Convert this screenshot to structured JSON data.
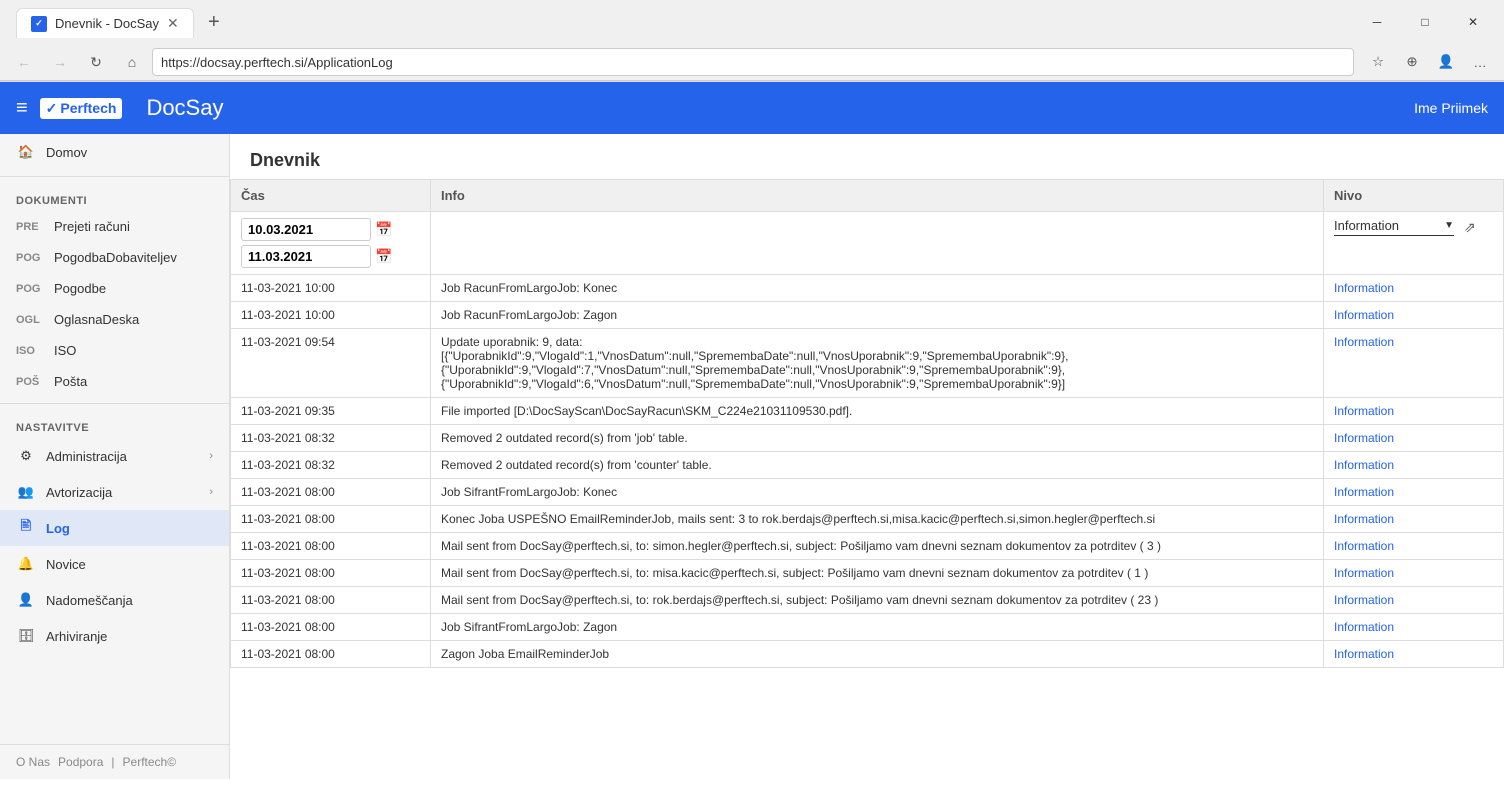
{
  "browser": {
    "tab_title": "Dnevnik - DocSay",
    "tab_favicon": "✓",
    "url": "https://docsay.perftech.si/ApplicationLog",
    "new_tab_btn": "+",
    "controls": {
      "minimize": "─",
      "maximize": "□",
      "close": "✕"
    }
  },
  "nav": {
    "back": "←",
    "forward": "→",
    "refresh": "↻",
    "home": "⌂"
  },
  "header": {
    "menu_icon": "≡",
    "logo_check": "✓",
    "logo_brand": "Perftech",
    "app_name": "DocSay",
    "user_name": "Ime Priimek"
  },
  "sidebar": {
    "domov_label": "Domov",
    "section_dokumenti": "DOKUMENTI",
    "items_dokumenti": [
      {
        "prefix": "PRE",
        "label": "Prejeti računi"
      },
      {
        "prefix": "POG",
        "label": "PogodbaDobaviteljev"
      },
      {
        "prefix": "POG",
        "label": "Pogodbe"
      },
      {
        "prefix": "OGL",
        "label": "OglasnaDeska"
      },
      {
        "prefix": "ISO",
        "label": "ISO"
      },
      {
        "prefix": "POŠ",
        "label": "Pošta"
      }
    ],
    "section_nastavitve": "NASTAVITVE",
    "items_nastavitve": [
      {
        "prefix": "",
        "label": "Administracija",
        "has_arrow": true
      },
      {
        "prefix": "",
        "label": "Avtorizacija",
        "has_arrow": true
      },
      {
        "prefix": "",
        "label": "Log",
        "active": true
      },
      {
        "prefix": "",
        "label": "Novice"
      },
      {
        "prefix": "",
        "label": "Nadomeščanja"
      },
      {
        "prefix": "",
        "label": "Arhiviranje"
      }
    ],
    "footer": {
      "o_nas": "O Nas",
      "podpora": "Podpora",
      "separator": "|",
      "perftech": "Perftech©"
    }
  },
  "page": {
    "title": "Dnevnik"
  },
  "table": {
    "headers": {
      "cas": "Čas",
      "info": "Info",
      "nivo": "Nivo"
    },
    "filter": {
      "date_from": "10.03.2021",
      "date_to": "11.03.2021",
      "level_value": "Information",
      "level_dropdown_arrow": "▼",
      "clear_icon": "⇗"
    },
    "rows": [
      {
        "time": "11-03-2021 10:00",
        "info": "Job RacunFromLargoJob: Konec",
        "level": "Information"
      },
      {
        "time": "11-03-2021 10:00",
        "info": "Job RacunFromLargoJob: Zagon",
        "level": "Information"
      },
      {
        "time": "11-03-2021 09:54",
        "info": "Update uporabnik: 9, data:\n[{\"UporabnikId\":9,\"VlogaId\":1,\"VnosDatum\":null,\"SpremembaDate\":null,\"VnosUporabnik\":9,\"SpremembaUporabnik\":9},\n{\"UporabnikId\":9,\"VlogaId\":7,\"VnosDatum\":null,\"SpremembaDate\":null,\"VnosUporabnik\":9,\"SpremembaUporabnik\":9},\n{\"UporabnikId\":9,\"VlogaId\":6,\"VnosDatum\":null,\"SpremembaDate\":null,\"VnosUporabnik\":9,\"SpremembaUporabnik\":9}]",
        "level": "Information"
      },
      {
        "time": "11-03-2021 09:35",
        "info": "File imported [D:\\DocSayScan\\DocSayRacun\\SKM_C224e21031109530.pdf].",
        "level": "Information"
      },
      {
        "time": "11-03-2021 08:32",
        "info": "Removed 2 outdated record(s) from 'job' table.",
        "level": "Information"
      },
      {
        "time": "11-03-2021 08:32",
        "info": "Removed 2 outdated record(s) from 'counter' table.",
        "level": "Information"
      },
      {
        "time": "11-03-2021 08:00",
        "info": "Job SifrantFromLargoJob: Konec",
        "level": "Information"
      },
      {
        "time": "11-03-2021 08:00",
        "info": "Konec Joba USPEŠNO EmailReminderJob, mails sent: 3 to rok.berdajs@perftech.si,misa.kacic@perftech.si,simon.hegler@perftech.si",
        "level": "Information"
      },
      {
        "time": "11-03-2021 08:00",
        "info": "Mail sent from DocSay@perftech.si, to: simon.hegler@perftech.si, subject: Pošiljamo vam dnevni seznam dokumentov za potrditev ( 3 )",
        "level": "Information"
      },
      {
        "time": "11-03-2021 08:00",
        "info": "Mail sent from DocSay@perftech.si, to: misa.kacic@perftech.si, subject: Pošiljamo vam dnevni seznam dokumentov za potrditev ( 1 )",
        "level": "Information"
      },
      {
        "time": "11-03-2021 08:00",
        "info": "Mail sent from DocSay@perftech.si, to: rok.berdajs@perftech.si, subject: Pošiljamo vam dnevni seznam dokumentov za potrditev ( 23 )",
        "level": "Information"
      },
      {
        "time": "11-03-2021 08:00",
        "info": "Job SifrantFromLargoJob: Zagon",
        "level": "Information"
      },
      {
        "time": "11-03-2021 08:00",
        "info": "Zagon Joba EmailReminderJob",
        "level": "Information"
      }
    ]
  }
}
